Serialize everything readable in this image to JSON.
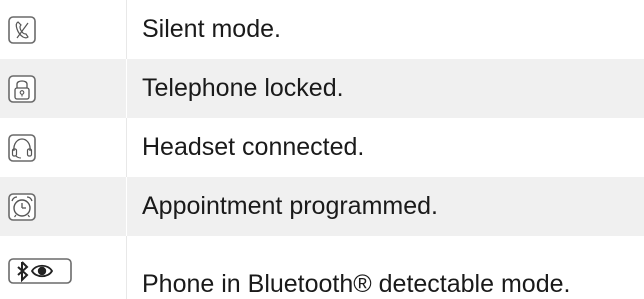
{
  "rows": [
    {
      "icon": "silent-mode-icon",
      "text": "Silent mode."
    },
    {
      "icon": "lock-icon",
      "text": "Telephone locked."
    },
    {
      "icon": "headset-icon",
      "text": "Headset connected."
    },
    {
      "icon": "alarm-clock-icon",
      "text": "Appointment programmed."
    },
    {
      "icon": "bluetooth-detectable-icon",
      "text": "Phone in Bluetooth® detectable mode."
    }
  ]
}
